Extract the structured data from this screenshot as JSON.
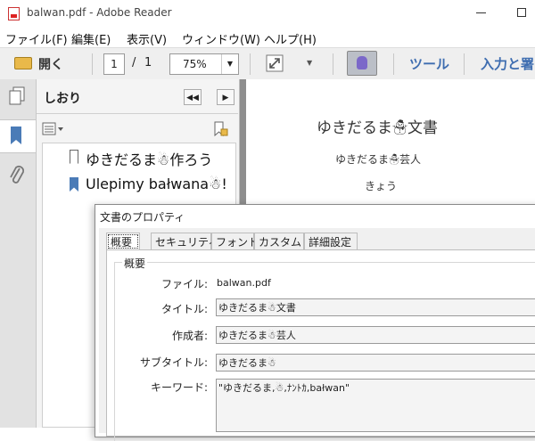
{
  "window": {
    "title": "balwan.pdf - Adobe Reader"
  },
  "menu": [
    "ファイル(F)",
    "編集(E)",
    "表示(V)",
    "ウィンドウ(W)",
    "ヘルプ(H)"
  ],
  "toolbar": {
    "open_label": "開く",
    "page_current": "1",
    "page_separator": "/",
    "page_total": "1",
    "zoom": "75%",
    "tools_label": "ツール",
    "sign_label": "入力と署"
  },
  "bookmarks": {
    "panel_title": "しおり",
    "items": [
      "ゆきだるま☃作ろう",
      "Ulepimy bałwana☃!"
    ]
  },
  "document": {
    "title": "ゆきだるま☃文書",
    "author": "ゆきだるま☃芸人",
    "line3": "きょう"
  },
  "dialog": {
    "title": "文書のプロパティ",
    "tabs": [
      "概要",
      "セキュリティ",
      "フォント",
      "カスタム",
      "詳細設定"
    ],
    "group_label": "概要",
    "fields": {
      "file_label": "ファイル:",
      "file_value": "balwan.pdf",
      "title_label": "タイトル:",
      "title_value": "ゆきだるま☃文書",
      "author_label": "作成者:",
      "author_value": "ゆきだるま☃芸人",
      "subtitle_label": "サブタイトル:",
      "subtitle_value": "ゆきだるま☃",
      "keywords_label": "キーワード:",
      "keywords_value": "\"ゆきだるま,☃,ﾅﾝﾄｶ,bałwan\""
    }
  }
}
